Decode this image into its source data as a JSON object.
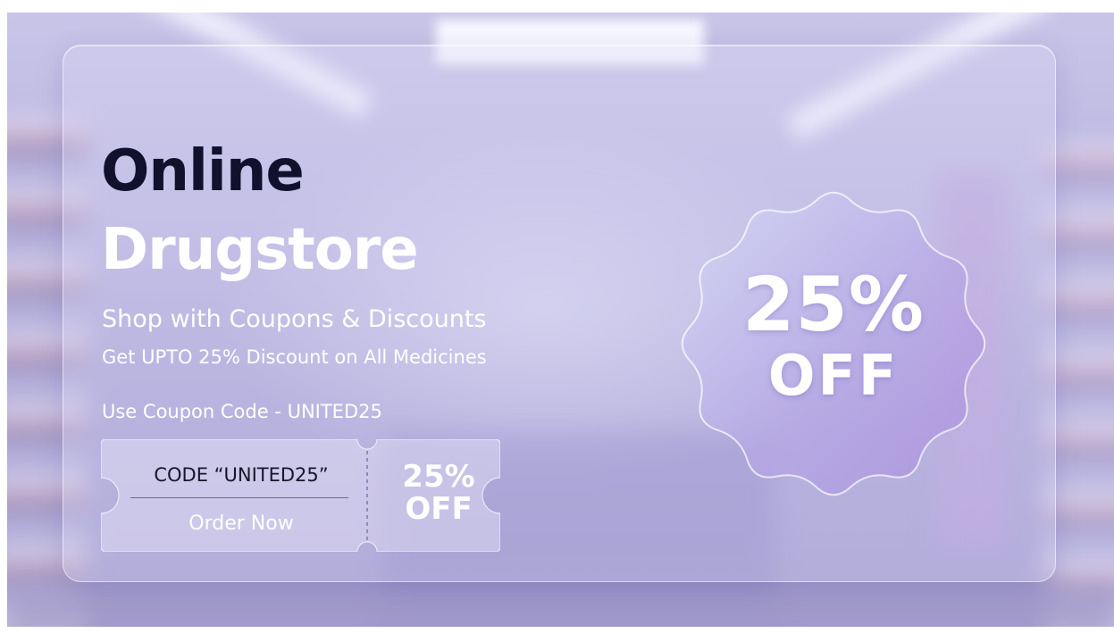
{
  "banner": {
    "headline_line1": "Online",
    "headline_line2": "Drugstore",
    "subtitle": "Shop with Coupons & Discounts",
    "detail": "Get UPTO 25% Discount on All Medicines",
    "coupon_line": "Use Coupon Code - UNITED25"
  },
  "ticket": {
    "code_label": "CODE “UNITED25”",
    "order_button": "Order Now",
    "discount_percent": "25%",
    "discount_off": "OFF"
  },
  "badge": {
    "percent": "25%",
    "off": "OFF"
  },
  "colors": {
    "headline_dark": "#11112e",
    "text_light": "#ffffff",
    "background_lavender": "#b9b4e0",
    "badge_violet": "#a98fdc"
  }
}
